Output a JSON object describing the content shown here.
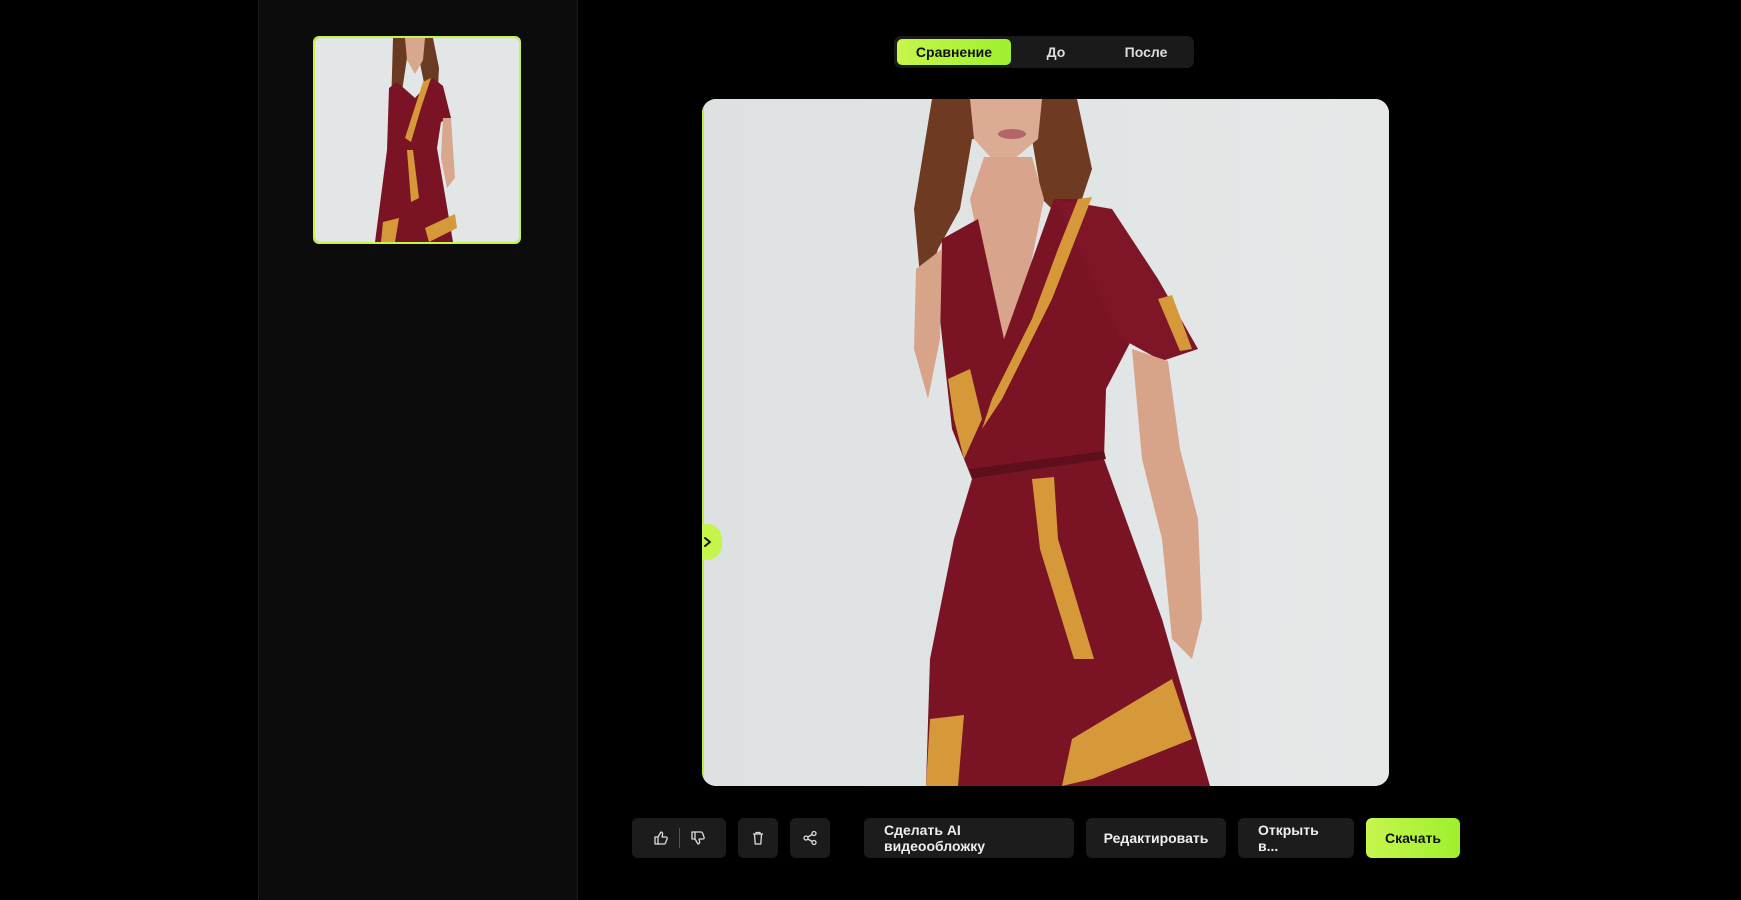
{
  "compare_tabs": [
    {
      "label": "Сравнение",
      "active": true
    },
    {
      "label": "До",
      "active": false
    },
    {
      "label": "После",
      "active": false
    }
  ],
  "toolbar": {
    "like_icon": "thumbs-up-icon",
    "dislike_icon": "thumbs-down-icon",
    "delete_icon": "trash-icon",
    "share_icon": "share-icon",
    "ai_video_cover_label": "Сделать AI видеообложку",
    "edit_label": "Редактировать",
    "open_in_label": "Открыть в...",
    "download_label": "Скачать"
  },
  "colors": {
    "accent": "#c4f54a",
    "dress": "#7a1424",
    "dress_trim": "#d6993a",
    "background": "#e3e6e7"
  }
}
